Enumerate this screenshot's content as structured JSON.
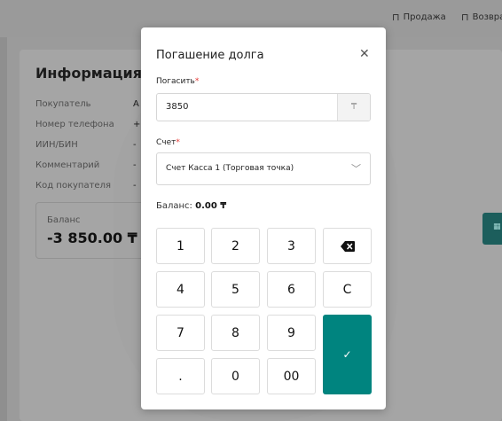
{
  "topbar": {
    "nav": [
      {
        "icon": "box-icon",
        "label": "Продажа"
      },
      {
        "icon": "return-icon",
        "label": "Возвра"
      }
    ]
  },
  "background": {
    "title": "Информация о",
    "fields": [
      {
        "label": "Покупатель",
        "value": "A"
      },
      {
        "label": "Номер телефона",
        "value": "+"
      },
      {
        "label": "ИИН/БИН",
        "value": "-"
      },
      {
        "label": "Комментарий",
        "value": "-"
      },
      {
        "label": "Код покупателя",
        "value": "-"
      }
    ],
    "balance_label": "Баланс",
    "balance_value": "-3 850.00 ₸"
  },
  "modal": {
    "title": "Погашение долга",
    "pay_label": "Погасить",
    "required_mark": "*",
    "amount": "3850",
    "currency": "₸",
    "account_label": "Счет",
    "account_value": "Счет Касса 1 (Торговая точка)",
    "balance_label": "Баланс:",
    "balance_value": "0.00 ₸",
    "keys": [
      "1",
      "2",
      "3",
      "4",
      "5",
      "6",
      "C",
      "7",
      "8",
      "9",
      ".",
      "0",
      "00"
    ],
    "enter_icon": "check-icon",
    "backspace_icon": "backspace-icon",
    "accent_color": "#00847f"
  }
}
